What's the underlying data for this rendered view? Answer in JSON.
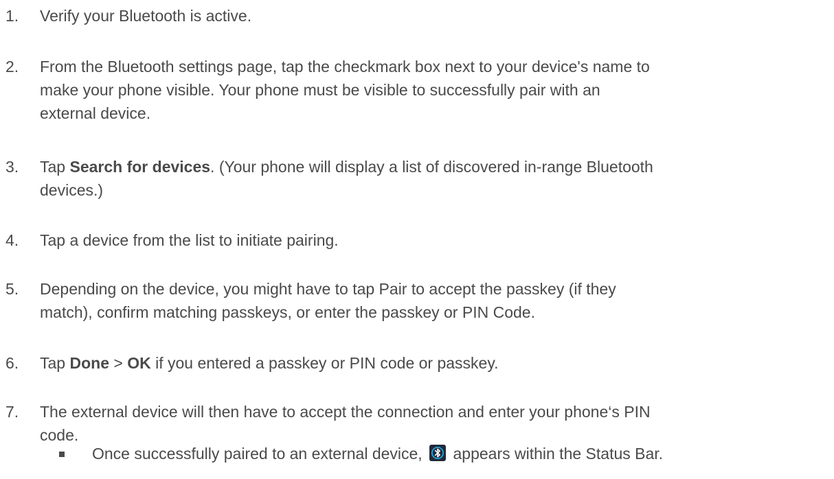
{
  "steps": [
    {
      "number": "1.",
      "parts": [
        {
          "text": "Verify your Bluetooth is active."
        }
      ]
    },
    {
      "number": "2.",
      "parts": [
        {
          "text": "From the Bluetooth settings page, tap the checkmark box next to your device's name to"
        },
        {
          "text": "make your phone visible. Your phone must be visible to successfully pair with an"
        },
        {
          "text": "external device."
        }
      ]
    },
    {
      "number": "3.",
      "prefix": "Tap ",
      "bold": "Search for devices",
      "suffix": ". (Your phone will display a list of discovered in-range Bluetooth",
      "line2": "devices.)"
    },
    {
      "number": "4.",
      "parts": [
        {
          "text": "Tap a device from the list to initiate pairing."
        }
      ]
    },
    {
      "number": "5.",
      "parts": [
        {
          "text": "Depending on the device, you might have to tap Pair to accept the passkey (if they"
        },
        {
          "text": "match), confirm matching passkeys, or enter the passkey or PIN Code."
        }
      ]
    },
    {
      "number": "6.",
      "prefix": "Tap ",
      "bold1": "Done",
      "middle": " > ",
      "bold2": "OK",
      "suffix": " if you entered a passkey or PIN code or passkey."
    },
    {
      "number": "7.",
      "parts": [
        {
          "text": "The external device will then have to accept the connection and enter your phone‘s PIN"
        },
        {
          "text": "code."
        }
      ]
    }
  ],
  "bullet": {
    "before_icon": "Once successfully paired to an external device, ",
    "icon": "bluetooth-icon",
    "after_icon": " appears within the Status Bar."
  },
  "colors": {
    "text": "#4a4a4a",
    "icon_bg": "#1f2a3a",
    "icon_ring": "#2aa3d8",
    "icon_fg": "#ffffff"
  }
}
